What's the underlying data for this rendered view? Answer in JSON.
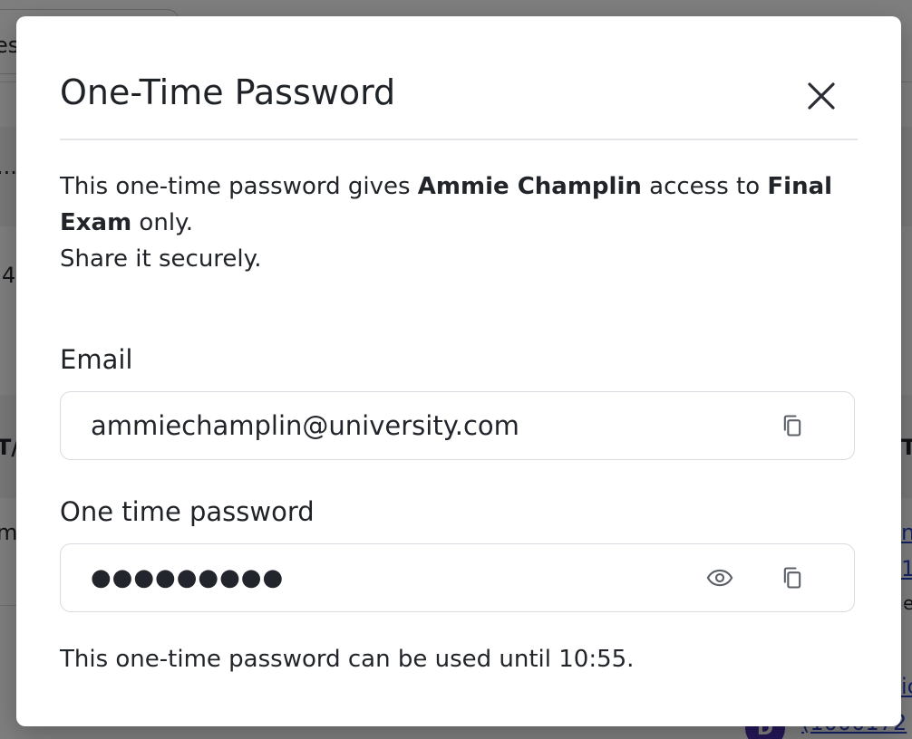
{
  "background": {
    "fragments": [
      "es.",
      "...",
      "4",
      "T/",
      "T",
      "m",
      "n",
      "1",
      "e",
      "ic",
      "(1000172"
    ],
    "avatar_letter": "D"
  },
  "modal": {
    "title": "One-Time Password",
    "description": {
      "part1": "This one-time password gives ",
      "student_name": "Ammie Champlin",
      "part2": " access to ",
      "exam_name": "Final Exam",
      "part3": " only.",
      "line2": "Share it securely."
    },
    "email": {
      "label": "Email",
      "value": "ammiechamplin@university.com"
    },
    "password": {
      "label": "One time password",
      "masked_value": "●●●●●●●●●"
    },
    "expiry_text": "This one-time password can be used until 10:55."
  },
  "icons": {
    "close": "close-icon",
    "copy": "copy-icon",
    "eye": "eye-icon"
  },
  "colors": {
    "overlay": "#000000",
    "link": "#2b44c8",
    "avatar": "#4a2fb0"
  }
}
